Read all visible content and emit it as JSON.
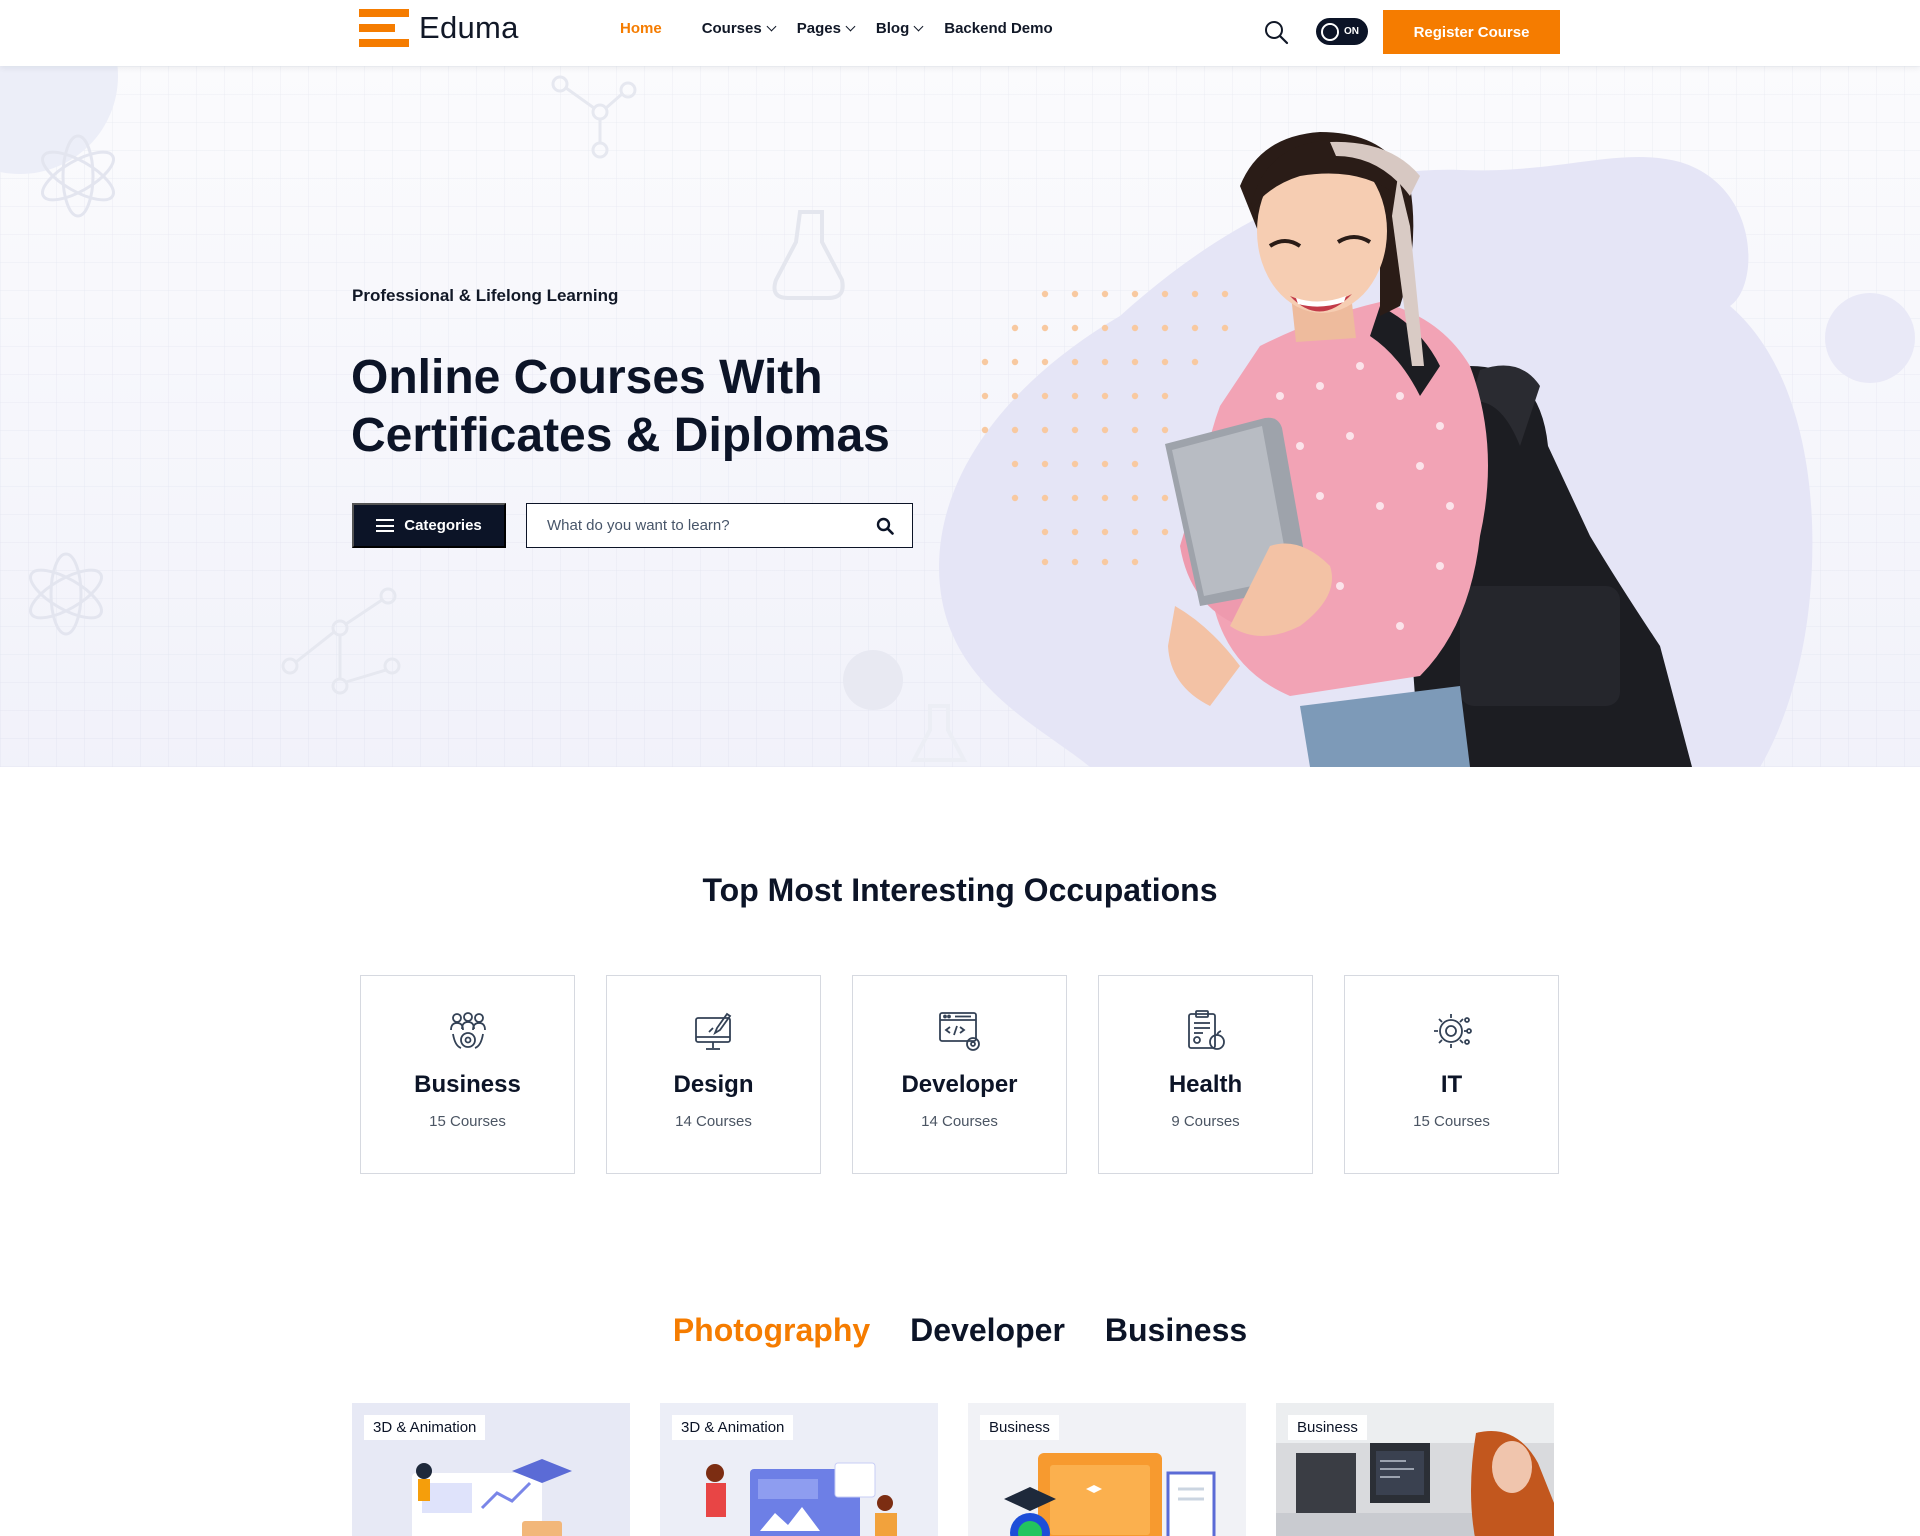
{
  "header": {
    "logo_text": "Eduma",
    "brand_color": "#f57c00",
    "nav": [
      {
        "label": "Home",
        "active": true,
        "dropdown": false
      },
      {
        "label": "Courses",
        "active": false,
        "dropdown": true
      },
      {
        "label": "Pages",
        "active": false,
        "dropdown": true
      },
      {
        "label": "Blog",
        "active": false,
        "dropdown": true
      },
      {
        "label": "Backend Demo",
        "active": false,
        "dropdown": false
      }
    ],
    "search_icon": "search-icon",
    "dark_mode_toggle": {
      "label": "ON",
      "icon": "moon-icon"
    },
    "register_label": "Register Course"
  },
  "hero": {
    "eyebrow": "Professional & Lifelong Learning",
    "title_line1": "Online Courses With",
    "title_line2": "Certificates & Diplomas",
    "categories_label": "Categories",
    "search_placeholder": "What do you want to learn?"
  },
  "occupations": {
    "title": "Top Most Interesting Occupations",
    "items": [
      {
        "name": "Business",
        "count": "15 Courses",
        "icon": "team-gear-icon"
      },
      {
        "name": "Design",
        "count": "14 Courses",
        "icon": "monitor-brush-icon"
      },
      {
        "name": "Developer",
        "count": "14 Courses",
        "icon": "code-window-icon"
      },
      {
        "name": "Health",
        "count": "9 Courses",
        "icon": "clipboard-apple-icon"
      },
      {
        "name": "IT",
        "count": "15 Courses",
        "icon": "gear-head-icon"
      }
    ]
  },
  "tabs": [
    {
      "label": "Photography",
      "active": true
    },
    {
      "label": "Developer",
      "active": false
    },
    {
      "label": "Business",
      "active": false
    }
  ],
  "courses": [
    {
      "tag": "3D & Animation"
    },
    {
      "tag": "3D & Animation"
    },
    {
      "tag": "Business"
    },
    {
      "tag": "Business"
    }
  ]
}
